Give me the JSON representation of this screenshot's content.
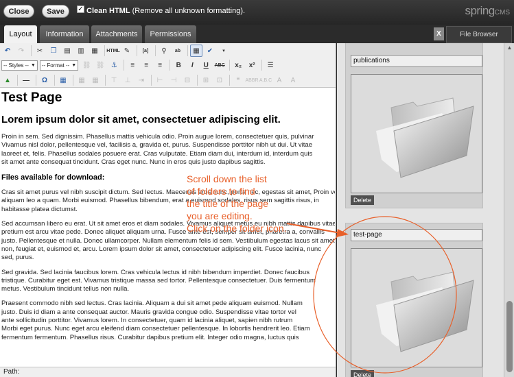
{
  "topbar": {
    "close_label": "Close",
    "save_label": "Save",
    "clean_html_checked": true,
    "clean_html_bold": "Clean HTML",
    "clean_html_note": "(Remove all unknown formatting).",
    "brand_main": "spring",
    "brand_suffix": "CMS"
  },
  "tabs": [
    {
      "label": "Layout",
      "active": true
    },
    {
      "label": "Information",
      "active": false
    },
    {
      "label": "Attachments",
      "active": false
    },
    {
      "label": "Permissions",
      "active": false
    }
  ],
  "file_browser": {
    "close_x": "X",
    "tab_label": "File Browser",
    "folders": [
      {
        "name": "publications",
        "delete_label": "Delete"
      },
      {
        "name": "test-page",
        "delete_label": "Delete"
      }
    ]
  },
  "toolbar": {
    "styles_select": "-- Styles --",
    "format_select": "-- Format --"
  },
  "document": {
    "title": "Test Page",
    "subtitle": "Lorem ipsum dolor sit amet, consectetuer adipiscing elit.",
    "para1": [
      "Proin in sem. Sed dignissim. Phasellus mattis vehicula odio. Proin augue lorem, consectetuer quis, pulvinar",
      "Vivamus nisl dolor, pellentesque vel, facilisis a, gravida et, purus. Suspendisse porttitor nibh ut dui. Ut vitae",
      "laoreet et, felis. Phasellus sodales posuere erat. Cras vulputate. Etiam diam dui, interdum id, interdum quis",
      "sit amet ante consequat tincidunt. Cras eget nunc. Nunc in eros quis justo dapibus sagittis."
    ],
    "files_heading": "Files available for download:",
    "para2": [
      "Cras sit amet purus vel nibh suscipit dictum. Sed lectus. Maecenas eros nunc, porta nec, egestas sit amet, Proin vestibulum",
      "aliquam leo a quam. Morbi euismod. Phasellus bibendum, erat a euismod sodales, risus sem sagittis risus, in",
      "habitasse platea dictumst."
    ],
    "para3": [
      "Sed accumsan libero eu erat. Ut sit amet eros et diam sodales. Vivamus aliquet metus eu nibh mattis dapibus vitae",
      "pretium est arcu vitae pede. Donec aliquet aliquam urna. Fusce ante est, semper sit amet, pharetra a, convallis",
      "justo. Pellentesque et nulla. Donec ullamcorper. Nullam elementum felis id sem. Vestibulum egestas lacus sit amet",
      "non, feugiat et, euismod et, arcu. Lorem ipsum dolor sit amet, consectetuer adipiscing elit. Fusce lacinia, nunc",
      "sed, purus."
    ],
    "para4": [
      "Sed gravida. Sed lacinia faucibus lorem. Cras vehicula lectus id nibh bibendum imperdiet. Donec faucibus",
      "tristique. Curabitur eget est. Vivamus tristique massa sed tortor. Pellentesque consectetuer. Duis fermentum",
      "metus. Vestibulum tincidunt tellus non nulla."
    ],
    "para5": [
      "Praesent commodo nibh sed lectus. Cras lacinia. Aliquam a dui sit amet pede aliquam euismod. Nullam",
      "justo. Duis id diam a ante consequat auctor. Mauris gravida congue odio. Suspendisse vitae tortor vel",
      "ante sollicitudin porttitor. Vivamus lorem. In consectetuer, quam id lacinia aliquet, sapien nibh rutrum",
      "Morbi eget purus. Nunc eget arcu eleifend diam consectetuer pellentesque. In lobortis hendrerit leo. Etiam",
      "fermentum fermentum. Phasellus risus. Curabitur dapibus pretium elit. Integer odio magna, luctus quis"
    ]
  },
  "path_label": "Path:",
  "annotation": {
    "lines": [
      "Scroll down the list",
      "of folders to find",
      "the title of the page",
      "you are editing.",
      "Click on the folder icon."
    ],
    "color": "#e8602a"
  }
}
